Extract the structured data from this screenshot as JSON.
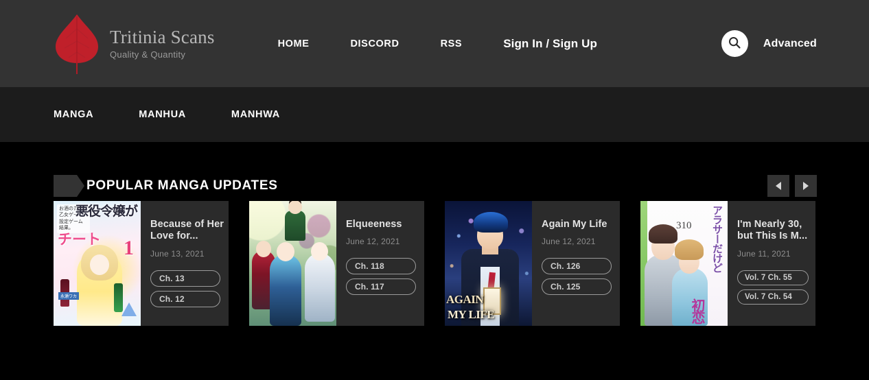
{
  "header": {
    "brand": {
      "title": "Tritinia Scans",
      "tagline": "Quality & Quantity",
      "logo_icon": "leaf-icon"
    },
    "nav": [
      {
        "label": "HOME",
        "name": "home"
      },
      {
        "label": "DISCORD",
        "name": "discord"
      },
      {
        "label": "RSS",
        "name": "rss"
      },
      {
        "label": "Sign In / Sign Up",
        "name": "sign-in-sign-up"
      }
    ],
    "search_icon": "search-icon",
    "advanced_label": "Advanced"
  },
  "subnav": [
    {
      "label": "MANGA",
      "name": "manga"
    },
    {
      "label": "MANHUA",
      "name": "manhua"
    },
    {
      "label": "MANHWA",
      "name": "manhwa"
    }
  ],
  "section": {
    "title": "POPULAR MANGA UPDATES",
    "prev_icon": "chevron-left-icon",
    "next_icon": "chevron-right-icon"
  },
  "cards": [
    {
      "title": "Because of Her Love for...",
      "date": "June 13, 2021",
      "chapters": [
        "Ch. 13",
        "Ch. 12"
      ],
      "cover": "cover-a",
      "cover_text": {
        "jp_big": "悪役令嬢が",
        "jp_pink": "チート",
        "jp_small": "お酒のために\\n乙女ゲー\\n設定ゲーム\\n結果。",
        "volume": "1"
      }
    },
    {
      "title": "Elqueeness",
      "date": "June 12, 2021",
      "chapters": [
        "Ch. 118",
        "Ch. 117"
      ],
      "cover": "cover-b",
      "cover_text": {}
    },
    {
      "title": "Again My Life",
      "date": "June 12, 2021",
      "chapters": [
        "Ch. 126",
        "Ch. 125"
      ],
      "cover": "cover-c",
      "cover_text": {
        "logo_line1": "AGAIN",
        "logo_line2": "MY LIFE"
      }
    },
    {
      "title": "I'm Nearly 30, but This Is M...",
      "date": "June 11, 2021",
      "chapters": [
        "Vol. 7 Ch. 55",
        "Vol. 7 Ch. 54"
      ],
      "cover": "cover-d",
      "cover_text": {
        "jp_v": "アラサーだけど",
        "jp_v2": "初恋",
        "number": "310"
      }
    }
  ],
  "colors": {
    "header_bg": "#333333",
    "subnav_bg": "#1c1c1c",
    "page_bg": "#000000",
    "card_bg": "#2b2b2b",
    "accent_red": "#c0202a",
    "text_primary": "#ffffff",
    "text_muted": "#8d8d8d"
  }
}
